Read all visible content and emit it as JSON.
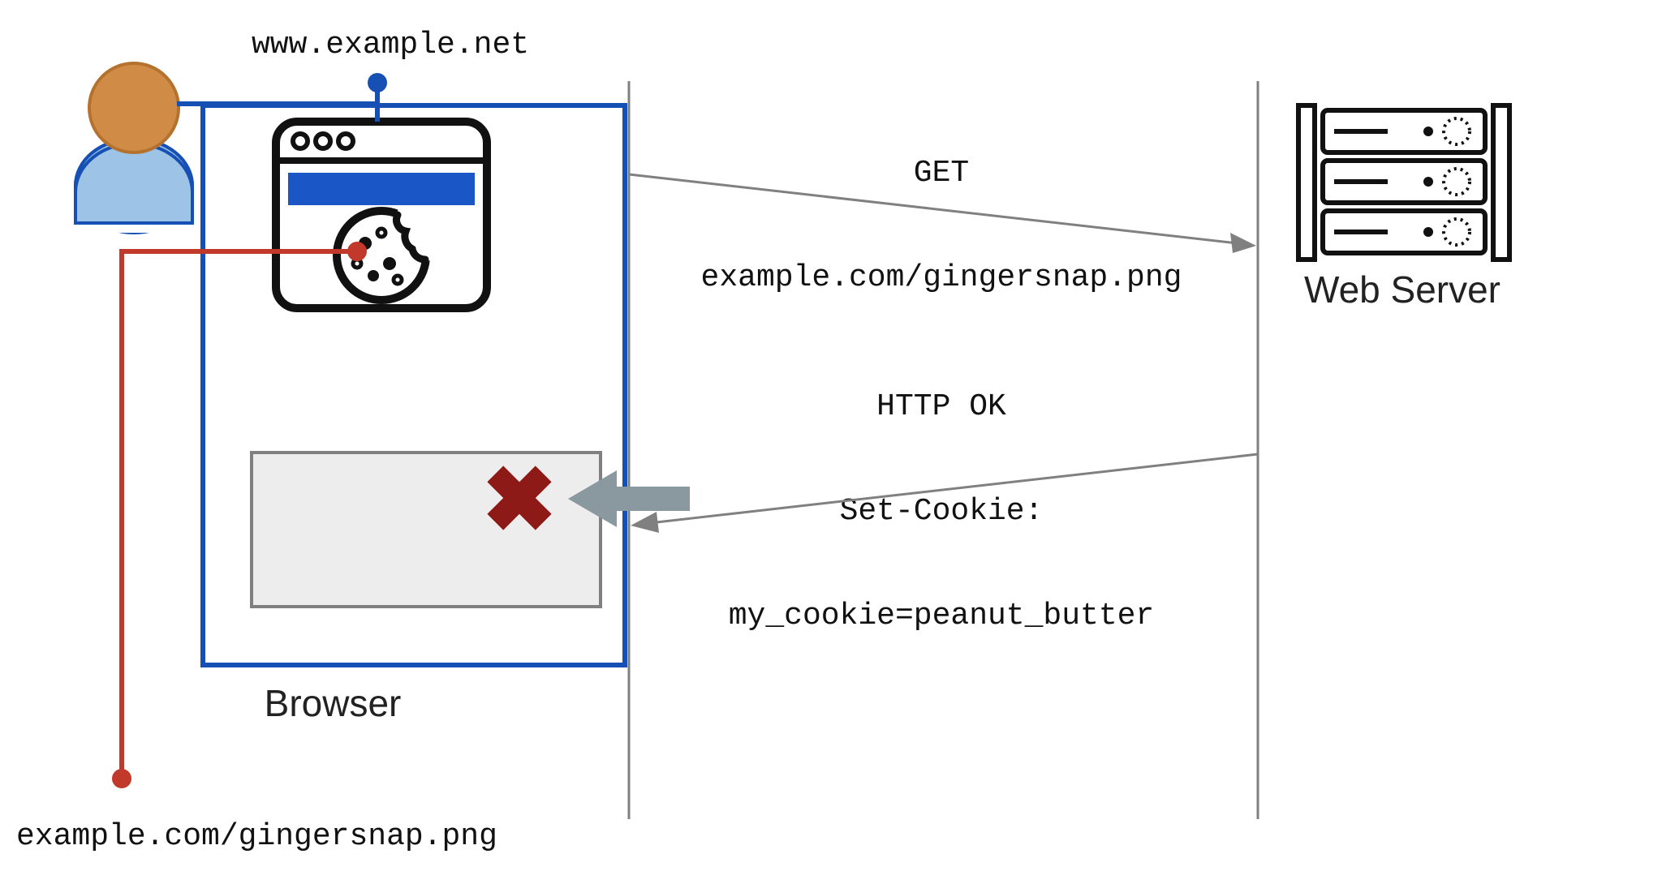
{
  "labels": {
    "browser": "Browser",
    "webserver": "Web Server"
  },
  "url": {
    "top": "www.example.net",
    "bottom": "example.com/gingersnap.png"
  },
  "request": {
    "line1": "GET",
    "line2": "example.com/gingersnap.png"
  },
  "response": {
    "line1": "HTTP OK",
    "line2": "Set-Cookie:",
    "line3": "my_cookie=peanut_butter"
  },
  "colors": {
    "blue": "#1750b5",
    "blueFill": "#1b56c7",
    "red": "#c0392b",
    "redX": "#8d1a16",
    "grey": "#808080",
    "greyArrow": "#8a98a0",
    "greyBox": "#ededed",
    "userHead": "#d08c47",
    "userBody": "#9dc3e6",
    "black": "#111111"
  }
}
